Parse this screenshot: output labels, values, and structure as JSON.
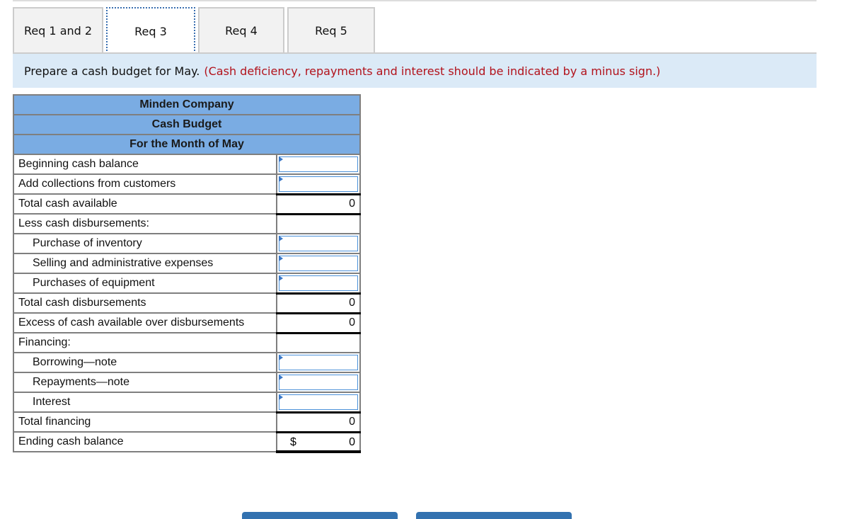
{
  "tabs": [
    {
      "label": "Req 1 and 2",
      "active": false
    },
    {
      "label": "Req 3",
      "active": true
    },
    {
      "label": "Req 4",
      "active": false
    },
    {
      "label": "Req 5",
      "active": false
    }
  ],
  "instruction": {
    "text": "Prepare a cash budget for May.",
    "note": "(Cash deficiency, repayments and interest should be indicated by a minus sign.)"
  },
  "budget": {
    "company": "Minden Company",
    "title": "Cash Budget",
    "period": "For the Month of May",
    "rows": [
      {
        "label": "Beginning cash balance",
        "type": "input",
        "value": ""
      },
      {
        "label": "Add collections from customers",
        "type": "input",
        "value": ""
      },
      {
        "label": "Total cash available",
        "type": "total",
        "value": "0"
      },
      {
        "label": "Less cash disbursements:",
        "type": "section",
        "value": ""
      },
      {
        "label": "Purchase of inventory",
        "type": "input",
        "value": ""
      },
      {
        "label": "Selling and administrative expenses",
        "type": "input",
        "value": ""
      },
      {
        "label": "Purchases of equipment",
        "type": "input",
        "value": ""
      },
      {
        "label": "Total cash disbursements",
        "type": "total",
        "value": "0"
      },
      {
        "label": "Excess of cash available over disbursements",
        "type": "total",
        "value": "0"
      },
      {
        "label": "Financing:",
        "type": "section",
        "value": ""
      },
      {
        "label": "Borrowing—note",
        "type": "input",
        "value": ""
      },
      {
        "label": "Repayments—note",
        "type": "input",
        "value": ""
      },
      {
        "label": "Interest",
        "type": "input",
        "value": ""
      },
      {
        "label": "Total financing",
        "type": "total",
        "value": "0"
      },
      {
        "label": "Ending cash balance",
        "type": "final",
        "currency": "$",
        "value": "0"
      }
    ]
  }
}
